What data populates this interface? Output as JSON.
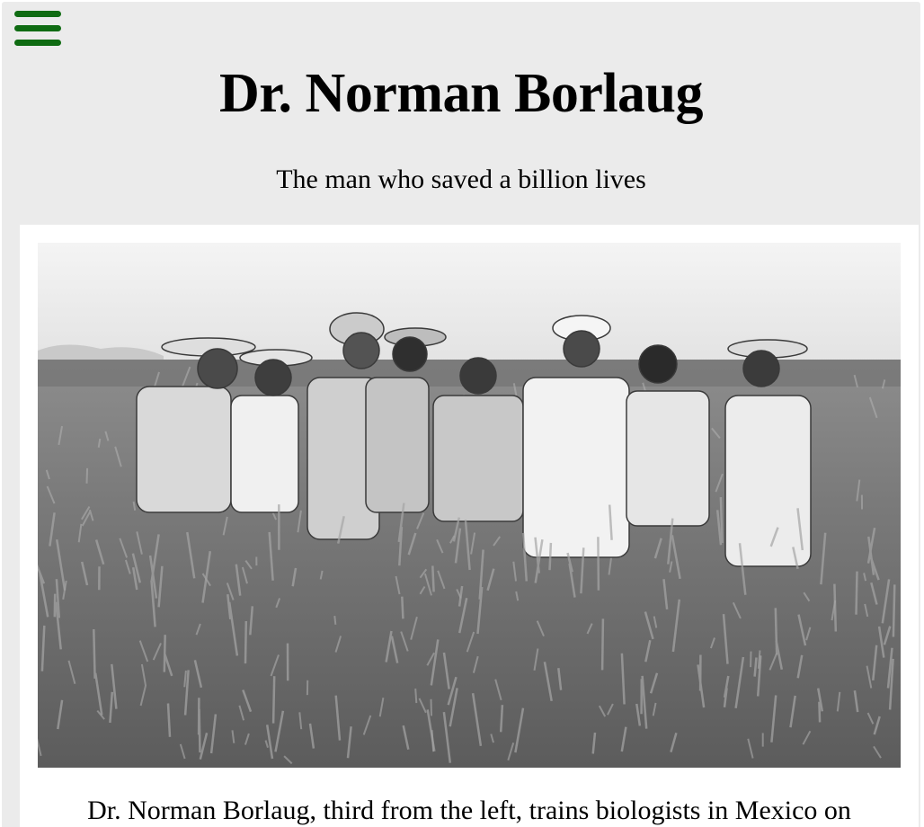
{
  "menu": {
    "icon": "hamburger-menu-icon",
    "color": "#0f6b12"
  },
  "header": {
    "title": "Dr. Norman Borlaug",
    "subtitle": "The man who saved a billion lives"
  },
  "figure": {
    "photo_description_icon": "black-and-white-field-photo",
    "caption": "Dr. Norman Borlaug, third from the left, trains biologists in Mexico on"
  },
  "colors": {
    "page_background": "#ebebeb",
    "card_background": "#ffffff",
    "accent": "#0f6b12"
  }
}
